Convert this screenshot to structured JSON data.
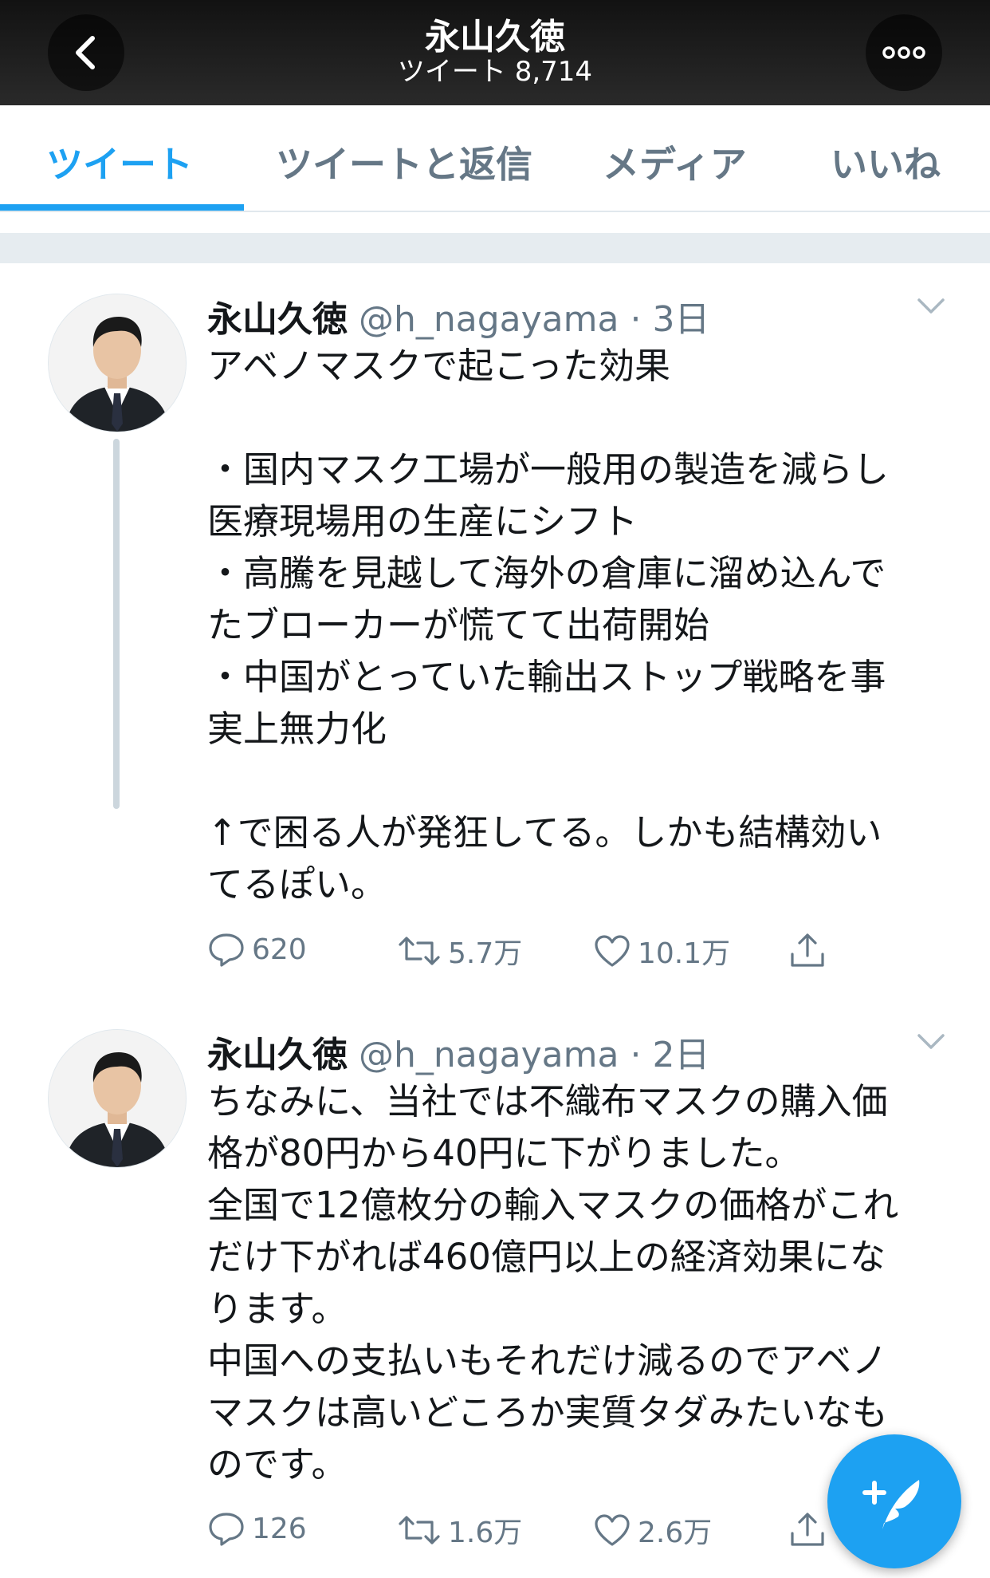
{
  "header": {
    "title": "永山久徳",
    "subtitle": "ツイート 8,714"
  },
  "tabs": [
    {
      "label": "ツイート",
      "active": true
    },
    {
      "label": "ツイートと返信",
      "active": false
    },
    {
      "label": "メディア",
      "active": false
    },
    {
      "label": "いいね",
      "active": false
    }
  ],
  "tweets": [
    {
      "name": "永山久徳",
      "handle": "@h_nagayama",
      "time": "3日",
      "lines": [
        "アベノマスクで起こった効果",
        "",
        "・国内マスク工場が一般用の製造を減らし",
        "医療現場用の生産にシフト",
        "・高騰を見越して海外の倉庫に溜め込んで",
        "たブローカーが慌てて出荷開始",
        "・中国がとっていた輸出ストップ戦略を事",
        "実上無力化",
        "",
        "↑で困る人が発狂してる。しかも結構効い",
        "てるぽい。"
      ],
      "replies": "620",
      "retweets": "5.7万",
      "likes": "10.1万"
    },
    {
      "name": "永山久徳",
      "handle": "@h_nagayama",
      "time": "2日",
      "lines": [
        "ちなみに、当社では不織布マスクの購入価",
        "格が80円から40円に下がりました。",
        "全国で12億枚分の輸入マスクの価格がこれ",
        "だけ下がれば460億円以上の経済効果にな",
        "ります。",
        "中国への支払いもそれだけ減るのでアベノ",
        "マスクは高いどころか実質タダみたいなも",
        "のです。"
      ],
      "replies": "126",
      "retweets": "1.6万",
      "likes": "2.6万"
    }
  ],
  "colors": {
    "accent": "#1da1f2",
    "secondary_text": "#657786",
    "thread_line": "#ccd6dd"
  },
  "icons": {
    "back": "chevron-left-icon",
    "more": "ellipsis-icon",
    "reply": "reply-icon",
    "retweet": "retweet-icon",
    "like": "heart-icon",
    "share": "share-icon",
    "compose": "compose-tweet-icon"
  }
}
